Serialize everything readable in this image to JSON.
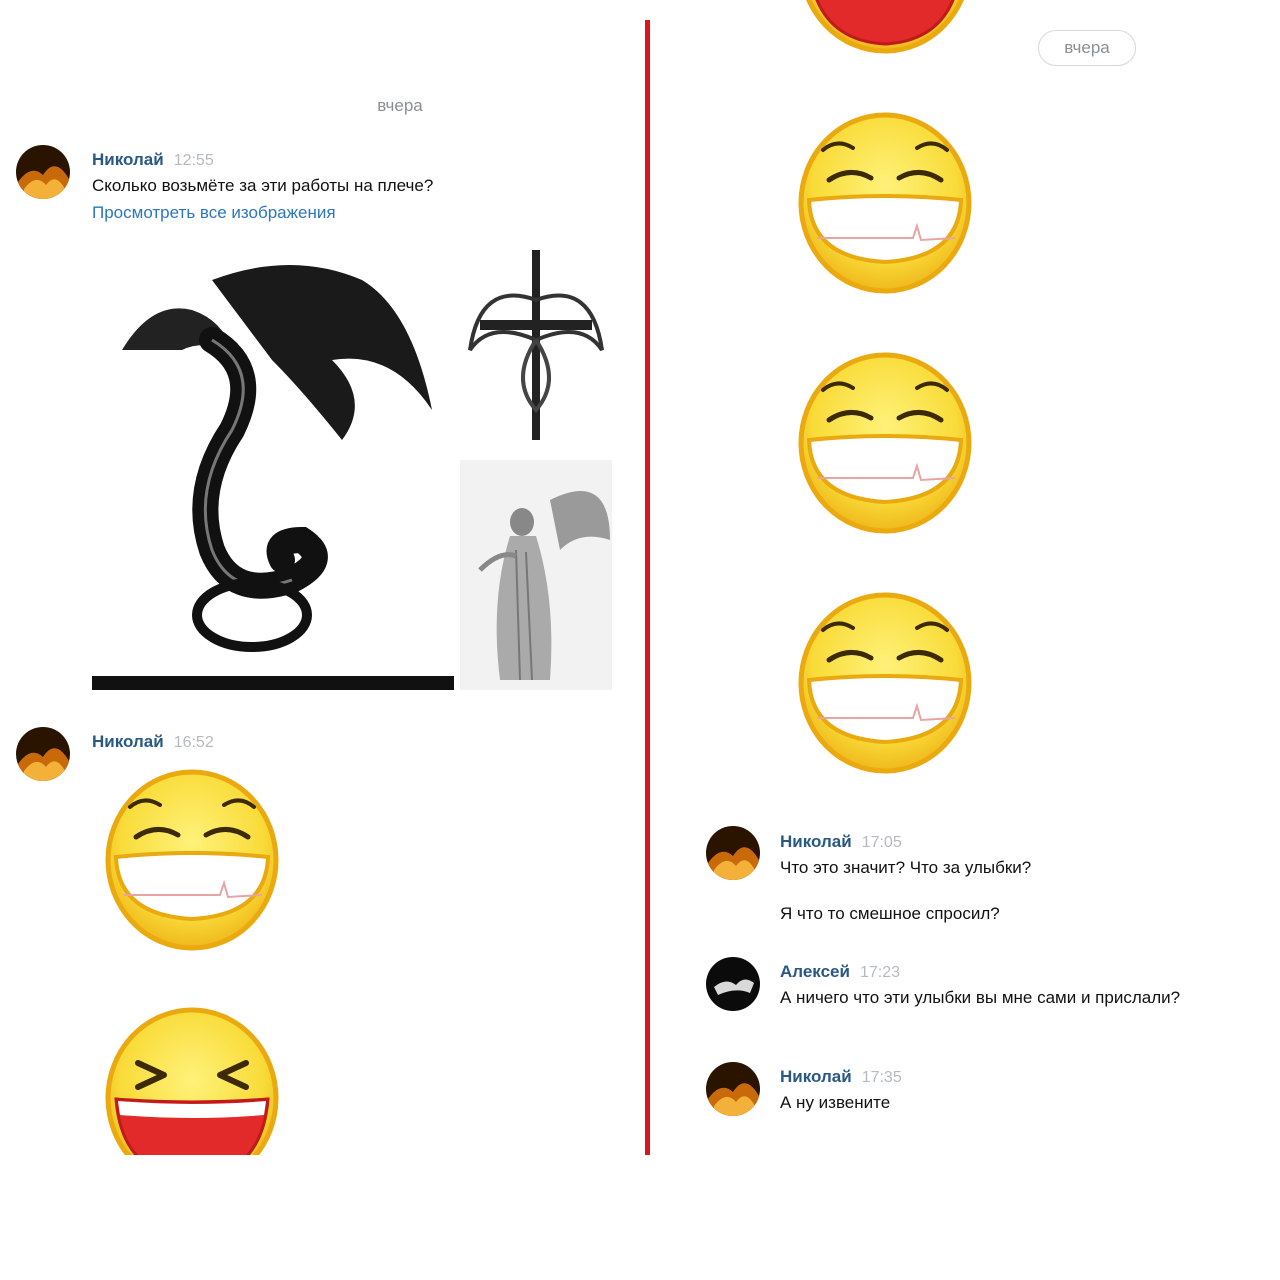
{
  "left": {
    "date": "вчера",
    "messages": [
      {
        "author": "Николай",
        "time": "12:55",
        "text": "Сколько возьмёте за эти работы на плече?",
        "link": "Просмотреть все изображения"
      },
      {
        "author": "Николай",
        "time": "16:52"
      }
    ]
  },
  "right": {
    "date": "вчера",
    "messages": [
      {
        "author": "Николай",
        "time": "17:05",
        "text1": "Что это значит? Что за улыбки?",
        "text2": "Я что то смешное спросил?"
      },
      {
        "author": "Алексей",
        "time": "17:23",
        "text": "А ничего что эти улыбки вы мне сами и прислали?"
      },
      {
        "author": "Николай",
        "time": "17:35",
        "text": "А ну извените"
      }
    ]
  },
  "colors": {
    "divider": "#d8161b",
    "author": "#2a5885",
    "link": "#2a77c0",
    "emoji_face": "#f8dd3a"
  },
  "icons": [
    "dragon-tattoo-image",
    "cross-dragon-tattoo-image",
    "angel-tattoo-image",
    "grinning-emoji",
    "laughing-emoji"
  ]
}
